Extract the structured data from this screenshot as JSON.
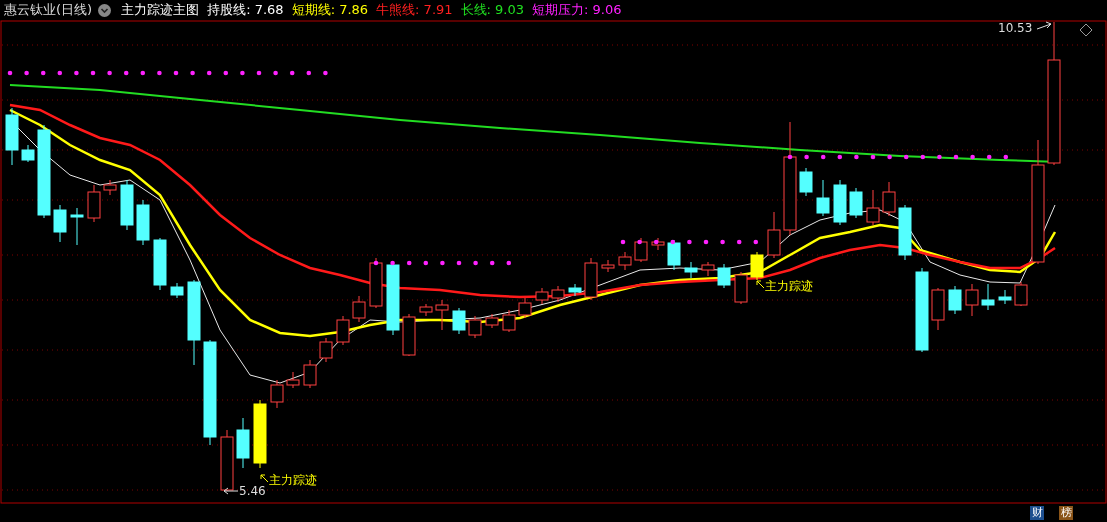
{
  "header": {
    "stock": "惠云钛业(日线)",
    "indicator_name": "主力踪迹主图",
    "readouts": [
      {
        "text": "持股线: 7.68",
        "color": "#ffffff"
      },
      {
        "text": "短期线: 7.86",
        "color": "#ffff00"
      },
      {
        "text": "牛熊线: 7.91",
        "color": "#ff2020"
      },
      {
        "text": "长线: 9.03",
        "color": "#20e020"
      },
      {
        "text": "短期压力: 9.06",
        "color": "#ff20ff"
      }
    ]
  },
  "chart": {
    "high_label": "10.53",
    "low_label": "5.46",
    "signals": [
      "主力踪迹",
      "主力踪迹"
    ]
  },
  "footer_badges": [
    {
      "text": "财",
      "color": "#1d4f8f"
    },
    {
      "text": "榜",
      "color": "#8a5418"
    }
  ]
}
